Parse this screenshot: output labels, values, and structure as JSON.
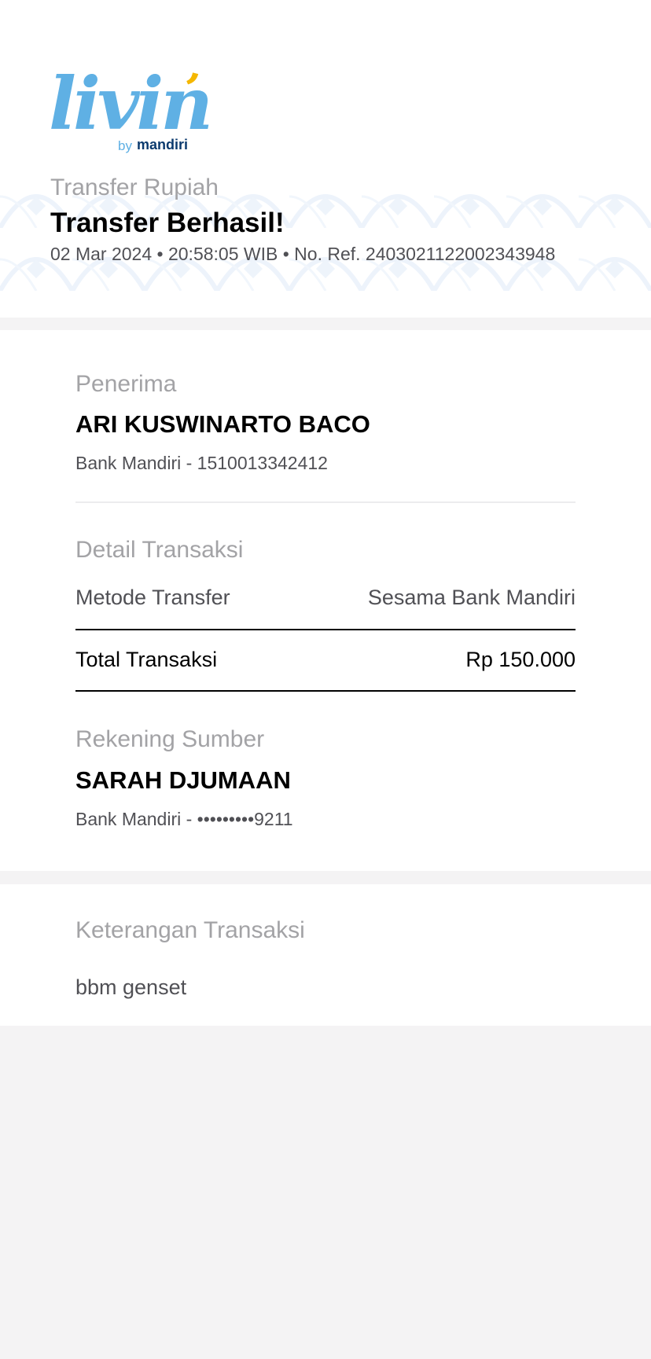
{
  "header": {
    "logo": {
      "script": "livin",
      "by": "by",
      "brand": "mandiri",
      "colors": {
        "script": "#5fb0e4",
        "accent": "#f5b700",
        "brand": "#0b3a6e"
      }
    },
    "subtitle": "Transfer Rupiah",
    "title": "Transfer Berhasil!",
    "meta": "02 Mar 2024 • 20:58:05 WIB • No. Ref. 2403021122002343948"
  },
  "recipient": {
    "label": "Penerima",
    "name": "ARI KUSWINARTO BACO",
    "account": "Bank Mandiri - 1510013342412"
  },
  "details": {
    "label": "Detail Transaksi",
    "method_label": "Metode Transfer",
    "method_value": "Sesama Bank Mandiri",
    "total_label": "Total Transaksi",
    "total_value": "Rp 150.000"
  },
  "source": {
    "label": "Rekening Sumber",
    "name": "SARAH DJUMAAN",
    "account": "Bank Mandiri - •••••••••9211"
  },
  "note": {
    "label": "Keterangan Transaksi",
    "value": "bbm genset"
  }
}
